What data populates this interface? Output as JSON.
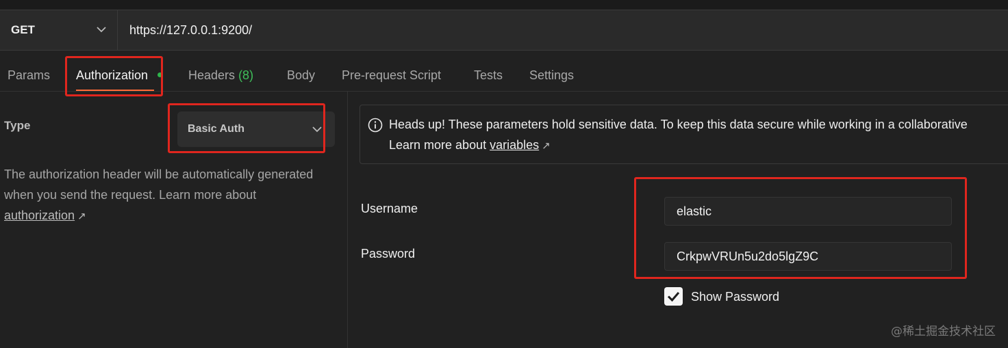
{
  "request": {
    "method": "GET",
    "url": "https://127.0.0.1:9200/"
  },
  "tabs": [
    {
      "label": "Params"
    },
    {
      "label": "Authorization"
    },
    {
      "label": "Headers",
      "count": "(8)"
    },
    {
      "label": "Body"
    },
    {
      "label": "Pre-request Script"
    },
    {
      "label": "Tests"
    },
    {
      "label": "Settings"
    }
  ],
  "auth": {
    "type_label": "Type",
    "type_value": "Basic Auth",
    "desc_text": "The authorization header will be automatically generated when you send the request. Learn more about ",
    "desc_link": "authorization",
    "link_arrow": "↗"
  },
  "notice": {
    "line1": "Heads up! These parameters hold sensitive data. To keep this data secure while working in a collaborative",
    "line2_prefix": "Learn more about ",
    "line2_link": "variables",
    "link_arrow": "↗"
  },
  "fields": {
    "username_label": "Username",
    "username_value": "elastic",
    "password_label": "Password",
    "password_value": "CrkpwVRUn5u2do5lgZ9C",
    "show_password_label": "Show Password",
    "show_password_checked": true
  },
  "watermark": "@稀土掘金技术社区",
  "colors": {
    "accent": "#ff6c37",
    "highlight": "#e0261e",
    "status_dot": "#2fb44b",
    "count": "#3fbf5a"
  },
  "icons": [
    "chevron-down-icon",
    "info-icon",
    "external-link-icon",
    "checkmark-icon"
  ]
}
